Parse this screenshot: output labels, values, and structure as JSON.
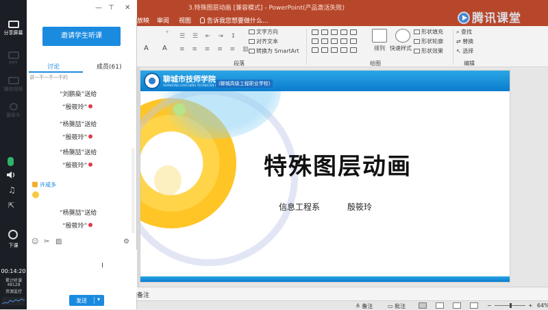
{
  "powerpoint": {
    "title": "3.特殊图层动画 [兼容模式] - PowerPoint(产品激活失败)",
    "menu": [
      "放映",
      "审阅",
      "视图"
    ],
    "tell_me": "告诉我您想要做什么...",
    "ribbon": {
      "text_direction": "文字方向",
      "align_text": "对齐文本",
      "to_smartart": "转换为 SmartArt",
      "arrange": "排列",
      "quick_styles": "快速样式",
      "shape_fill": "形状填充",
      "shape_outline": "形状轮廓",
      "shape_effects": "形状效果",
      "find": "查找",
      "replace": "替换",
      "select": "选择",
      "group_paragraph": "段落",
      "group_drawing": "绘图",
      "group_editing": "编辑"
    },
    "slide": {
      "school_name": "聊城市技师学院",
      "school_name_en": "SHANDONG LIAOCHENG TECHNICIAN COLLEGE",
      "school_sub": "(聊城高级工程职业学校)",
      "title": "特殊图层动画",
      "department": "信息工程系",
      "author": "殷筱玲"
    },
    "notes_label": "备注",
    "status": {
      "notes": "备注",
      "comments": "批注",
      "zoom": "64%"
    }
  },
  "watermark": "腾讯课堂",
  "tencent": {
    "sidebar": {
      "share_screen": "分享屏幕",
      "ppt": "PPT",
      "play_video": "播放视频",
      "camera": "摄像头",
      "exit": "下课",
      "time": "00:14:20",
      "stat_label1": "累计听课",
      "stat_value": "48128",
      "stat_label2": "资源监控"
    },
    "panel": {
      "window_controls": [
        "—",
        "⊤",
        "✕"
      ],
      "invite_button": "邀请学生听课",
      "tab_discuss": "讨论",
      "tab_members": "成员(61)",
      "cut_line": "讲一不一不一不的",
      "gifts": [
        {
          "from": "“刘鹏燊”送给",
          "to": "“殷筱玲”"
        },
        {
          "from": "“杨龑喆”送给",
          "to": "“殷筱玲”"
        },
        {
          "from": "“杨龑喆”送给",
          "to": "“殷筱玲”"
        },
        {
          "from": "“杨龑喆”送给",
          "to": "“殷筱玲”"
        }
      ],
      "sender": "许咸多",
      "send_button": "发送",
      "send_arrow": "▾"
    }
  }
}
